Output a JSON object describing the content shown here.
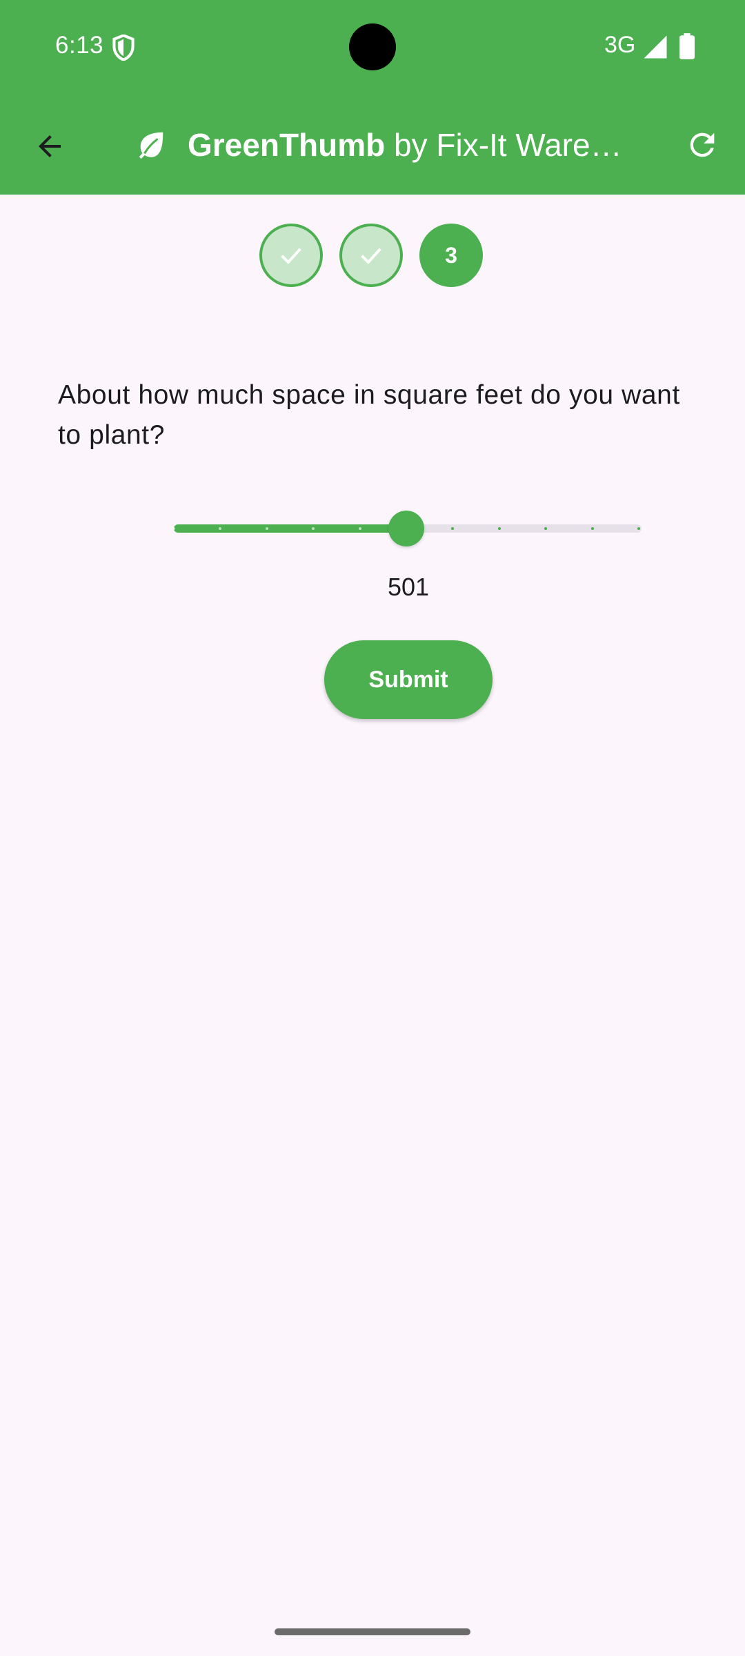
{
  "status_bar": {
    "time": "6:13",
    "network": "3G",
    "icons": [
      "shield-icon",
      "signal-icon",
      "battery-icon"
    ]
  },
  "app_bar": {
    "title_brand": "GreenThumb",
    "title_rest": " by Fix-It Wareh…",
    "icons": [
      "back-arrow-icon",
      "leaf-icon",
      "refresh-icon"
    ]
  },
  "stepper": {
    "steps": [
      {
        "state": "completed",
        "icon": "check-icon"
      },
      {
        "state": "completed",
        "icon": "check-icon"
      },
      {
        "state": "active",
        "label": "3"
      }
    ]
  },
  "question": {
    "text": "About how much space in square feet do you want to plant?"
  },
  "slider": {
    "value_label": "501",
    "fraction": 0.5,
    "divisions": 10
  },
  "submit": {
    "label": "Submit"
  },
  "colors": {
    "primary": "#4caf50",
    "primary_container": "#c8e6c9",
    "background": "#fcf6fc",
    "track_inactive": "#e6e0e9"
  }
}
